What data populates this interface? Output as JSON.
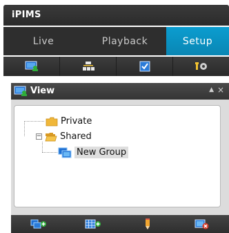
{
  "app": {
    "title": "iPIMS"
  },
  "tabs": [
    {
      "label": "Live"
    },
    {
      "label": "Playback"
    },
    {
      "label": "Setup",
      "active": true
    }
  ],
  "toolbar": {
    "icons": [
      "monitor-user-icon",
      "network-icon",
      "checklist-icon",
      "settings-icon"
    ]
  },
  "panel": {
    "title": "View",
    "collapse_glyph": "▲",
    "close_glyph": "×"
  },
  "tree": {
    "items": [
      {
        "label": "Private",
        "type": "folder"
      },
      {
        "label": "Shared",
        "type": "folder",
        "expanded": true
      },
      {
        "label": "New Group",
        "type": "group",
        "selected": true
      }
    ],
    "expander_glyph": "−"
  },
  "bottom_toolbar": {
    "icons": [
      "add-group-icon",
      "add-layout-icon",
      "edit-icon",
      "delete-icon"
    ]
  },
  "colors": {
    "accent": "#0a94c6",
    "titlebar": "#2e2e2e",
    "folder": "#f0b73a",
    "add_green": "#2fae3a",
    "delete_red": "#d23b2a"
  }
}
